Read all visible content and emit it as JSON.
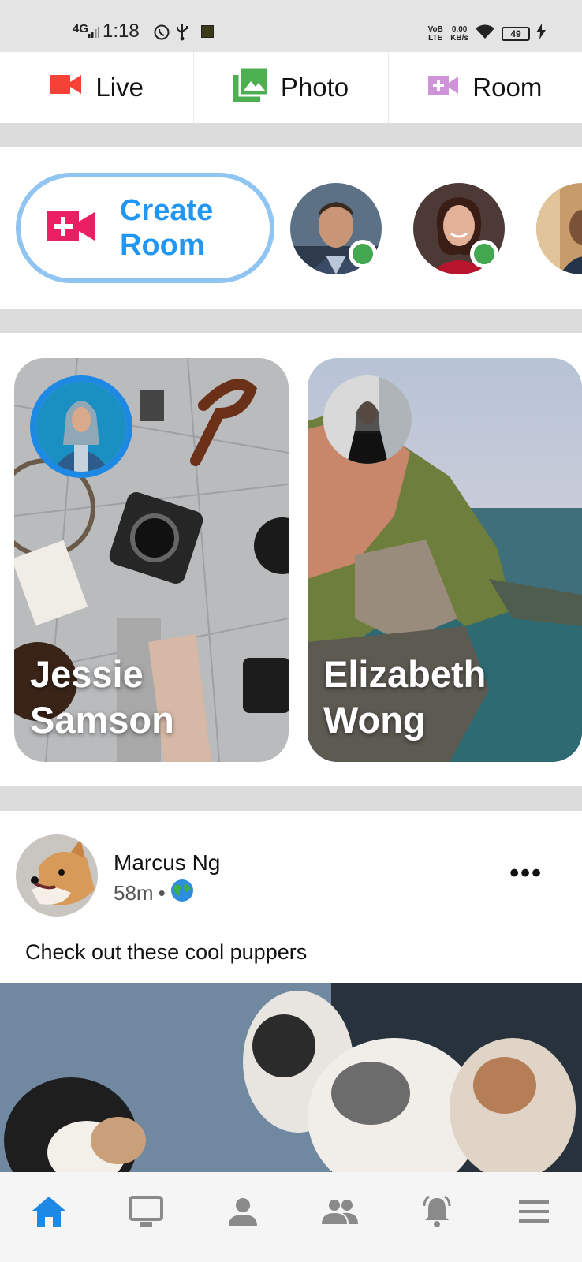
{
  "status_bar": {
    "network": "4G",
    "time": "1:18",
    "volte": "VoB LTE",
    "speed_value": "0.00",
    "speed_unit": "KB/s",
    "battery": "49"
  },
  "actions": [
    {
      "label": "Live",
      "icon": "video-camera-icon",
      "color": "#f44336"
    },
    {
      "label": "Photo",
      "icon": "photo-library-icon",
      "color": "#4caf50"
    },
    {
      "label": "Room",
      "icon": "video-call-icon",
      "color": "#ce93d8"
    }
  ],
  "rooms": {
    "create_label": "Create Room",
    "create_line1": "Create",
    "create_line2": "Room",
    "accent": "#2196f3",
    "border": "#90c4f1",
    "online_color": "#43a84f"
  },
  "stories": [
    {
      "first": "Jessie",
      "last": "Samson"
    },
    {
      "first": "Elizabeth",
      "last": "Wong"
    }
  ],
  "post": {
    "author": "Marcus Ng",
    "time": "58m",
    "visibility_icon": "globe-icon",
    "caption": "Check out these cool puppers",
    "more": "•••"
  },
  "bottom_nav": [
    {
      "name": "home-icon",
      "active": true
    },
    {
      "name": "watch-icon",
      "active": false
    },
    {
      "name": "profile-icon",
      "active": false
    },
    {
      "name": "groups-icon",
      "active": false
    },
    {
      "name": "notifications-icon",
      "active": false
    },
    {
      "name": "menu-icon",
      "active": false
    }
  ],
  "colors": {
    "active_nav": "#1e88e5",
    "inactive_nav": "#8a8a8a"
  }
}
